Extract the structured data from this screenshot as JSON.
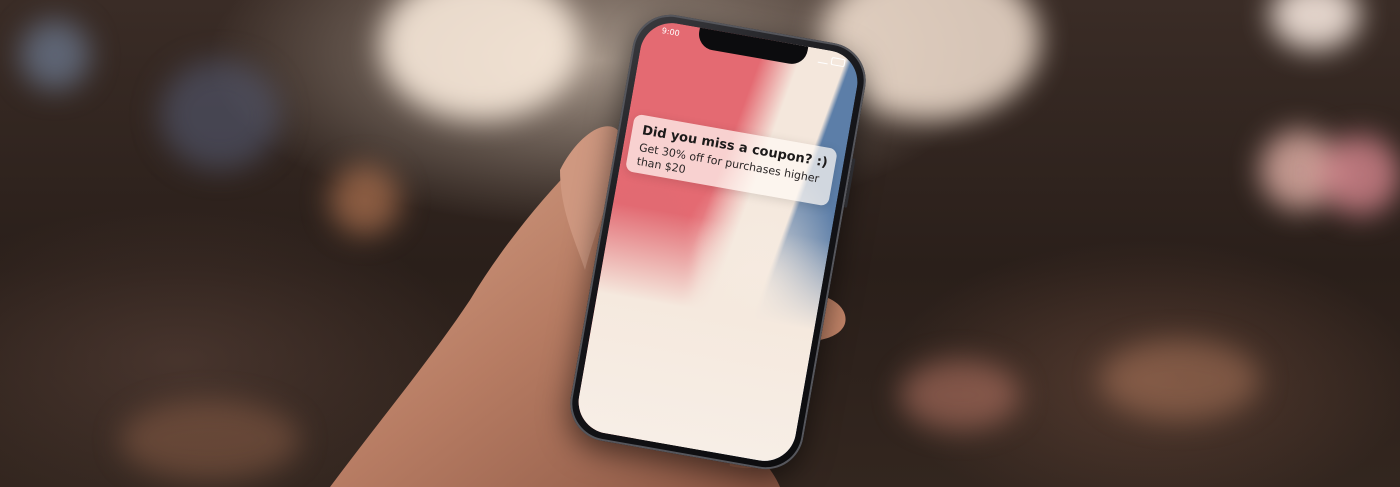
{
  "phone": {
    "status_time": "9:00",
    "notification": {
      "title": "Did you miss a coupon? :)",
      "body": "Get 30% off for purchases higher than $20"
    }
  },
  "colors": {
    "background": "#2a1f19",
    "screen_pink": "#e46a72",
    "screen_blue": "#5c7ea8",
    "screen_cream": "#f4e7dc"
  }
}
